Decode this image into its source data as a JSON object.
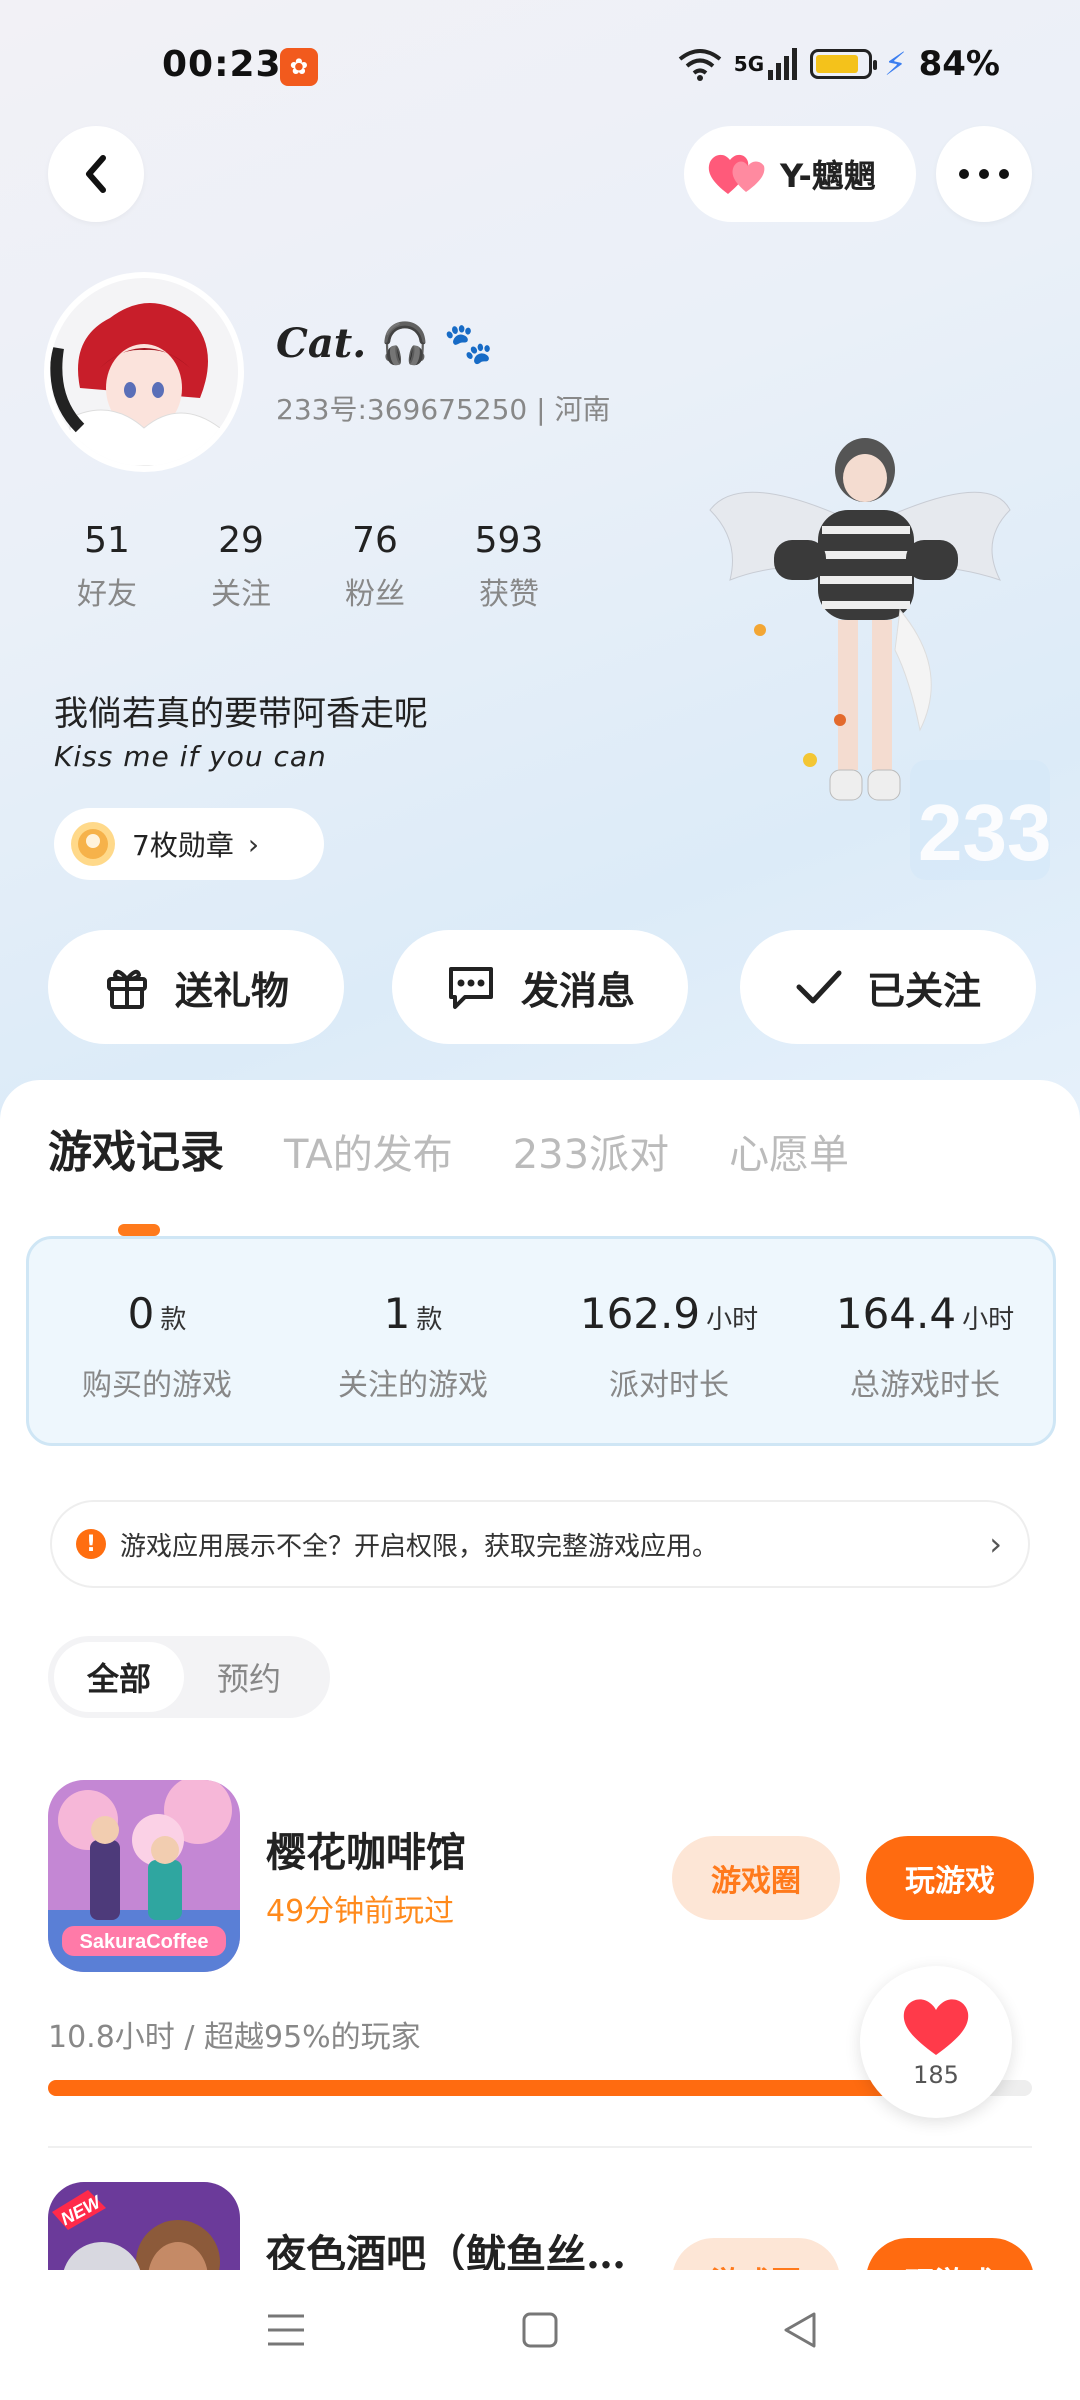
{
  "status_bar": {
    "time": "00:23",
    "network": "5G",
    "battery": "84%"
  },
  "header": {
    "friend_name": "Y-魑魍"
  },
  "profile": {
    "username": "Cat.",
    "id_line": "233号:369675250 | 河南",
    "stats": [
      {
        "value": "51",
        "label": "好友"
      },
      {
        "value": "29",
        "label": "关注"
      },
      {
        "value": "76",
        "label": "粉丝"
      },
      {
        "value": "593",
        "label": "获赞"
      }
    ],
    "bio_line1": "我倘若真的要带阿香走呢",
    "bio_line2": "Kiss me if you can",
    "medals": "7枚勋章"
  },
  "actions": {
    "gift": "送礼物",
    "message": "发消息",
    "follow": "已关注"
  },
  "tabs": [
    "游戏记录",
    "TA的发布",
    "233派对",
    "心愿单"
  ],
  "record": [
    {
      "value": "0",
      "unit": "款",
      "label": "购买的游戏"
    },
    {
      "value": "1",
      "unit": "款",
      "label": "关注的游戏"
    },
    {
      "value": "162.9",
      "unit": "小时",
      "label": "派对时长"
    },
    {
      "value": "164.4",
      "unit": "小时",
      "label": "总游戏时长"
    }
  ],
  "notice": "游戏应用展示不全？开启权限，获取完整游戏应用。",
  "filters": [
    "全部",
    "预约"
  ],
  "games": [
    {
      "title": "樱花咖啡馆",
      "subtitle": "49分钟前玩过",
      "circle_btn": "游戏圈",
      "play_btn": "玩游戏",
      "stat": "10.8小时 / 超越95%的玩家",
      "progress": 0.95,
      "icon_text": "SakuraCoffee"
    },
    {
      "title": "夜色酒吧（鱿鱼丝…",
      "circle_btn": "游戏圈",
      "play_btn": "玩游戏",
      "icon_text": "NEW"
    }
  ],
  "likes": "185",
  "colors": {
    "accent": "#ff6b10",
    "accent_light": "#fde6d6",
    "card_bg": "#eef7fd"
  }
}
